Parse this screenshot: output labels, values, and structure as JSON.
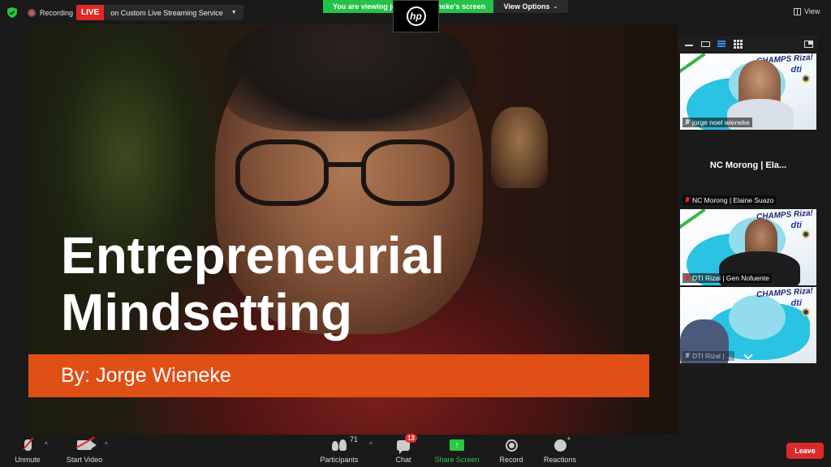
{
  "topbar": {
    "recording_label": "Recording",
    "live_badge": "LIVE",
    "live_service": "on Custom Live Streaming Service",
    "viewing_banner": "You are viewing jo",
    "viewing_banner_suffix": "neke's screen",
    "view_options": "View Options",
    "hp_logo": "hp",
    "view_label": "View"
  },
  "slide": {
    "title_line1": "Entrepreneurial",
    "title_line2": "Mindsetting",
    "author": "By: Jorge Wieneke",
    "bar_color": "#e04f16"
  },
  "panel": {
    "tiles": [
      {
        "name": "jorge noel wieneke",
        "muted": false,
        "active": true,
        "brand_title": "CHAMPS Riza!",
        "brand_sub": "dti"
      },
      {
        "display_name": "NC Morong | Ela...",
        "name": "NC Morong | Elaine Suazo",
        "muted": true,
        "video": false
      },
      {
        "name": "DTI Rizal | Gen Nofuente",
        "muted": true,
        "brand_title": "CHAMPS Riza!",
        "brand_sub": "dti"
      },
      {
        "name": "DTI Rizal | ...",
        "muted": true,
        "brand_title": "CHAMPS Riza!",
        "brand_sub": "dti"
      }
    ]
  },
  "toolbar": {
    "unmute": "Unmute",
    "start_video": "Start Video",
    "participants": "Participants",
    "participants_count": "71",
    "chat": "Chat",
    "chat_badge": "13",
    "share_screen": "Share Screen",
    "record": "Record",
    "reactions": "Reactions",
    "leave": "Leave",
    "accent_green": "#27c93f",
    "accent_red": "#d92b2b"
  }
}
